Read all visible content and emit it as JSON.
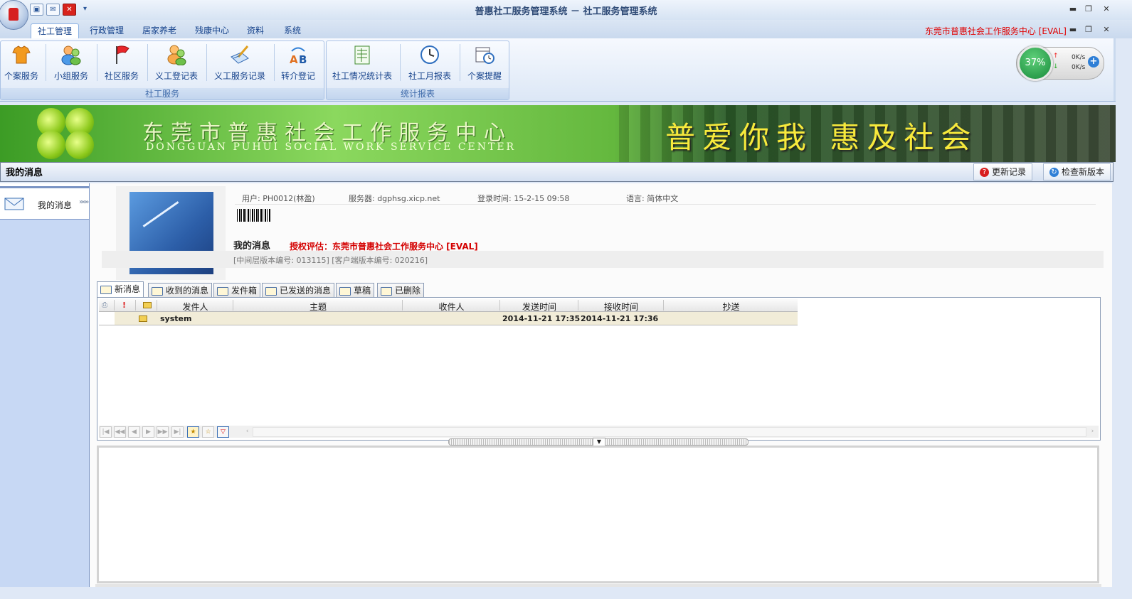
{
  "window": {
    "title": "普惠社工服务管理系统 － 社工服务管理系统",
    "eval_title": "东莞市普惠社会工作服务中心 [EVAL]"
  },
  "ribbon_tabs": [
    "社工管理",
    "行政管理",
    "居家养老",
    "残康中心",
    "资料",
    "系统"
  ],
  "ribbon_groups": {
    "social_work": {
      "label": "社工服务",
      "buttons": [
        "个案服务",
        "小组服务",
        "社区服务",
        "义工登记表",
        "义工服务记录",
        "转介登记"
      ]
    },
    "reports": {
      "label": "统计报表",
      "buttons": [
        "社工情况统计表",
        "社工月报表",
        "个案提醒"
      ]
    }
  },
  "speed_widget": {
    "percent": "37%",
    "up": "0K/s",
    "down": "0K/s"
  },
  "banner": {
    "name_cn": "东莞市普惠社会工作服务中心",
    "name_en": "DONGGUAN PUHUI SOCIAL WORK SERVICE CENTER",
    "slogan": "普爱你我 惠及社会"
  },
  "header": {
    "title": "我的消息",
    "update_log": "更新记录",
    "check_version": "检查新版本"
  },
  "left_nav": {
    "item": "我的消息",
    "arrows": "»»»"
  },
  "user_info": {
    "user": "用户: PH0012(林盈)",
    "server": "服务器: dgphsg.xicp.net",
    "login_time": "登录时间: 15-2-15 09:58",
    "language": "语言: 简体中文",
    "section_title": "我的消息",
    "license": "授权评估：东莞市普惠社会工作服务中心 [EVAL]",
    "version": "[中间层版本编号: 013115]  [客户端版本编号: 020216]"
  },
  "message_tabs": [
    "新消息",
    "收到的消息",
    "发件箱",
    "已发送的消息",
    "草稿",
    "已删除"
  ],
  "grid": {
    "columns": [
      "发件人",
      "主题",
      "收件人",
      "发送时间",
      "接收时间",
      "抄送"
    ],
    "rows": [
      {
        "sender": "system",
        "subject": "",
        "recipient": "",
        "sent": "2014-11-21 17:35",
        "received": "2014-11-21 17:36",
        "cc": ""
      }
    ]
  }
}
